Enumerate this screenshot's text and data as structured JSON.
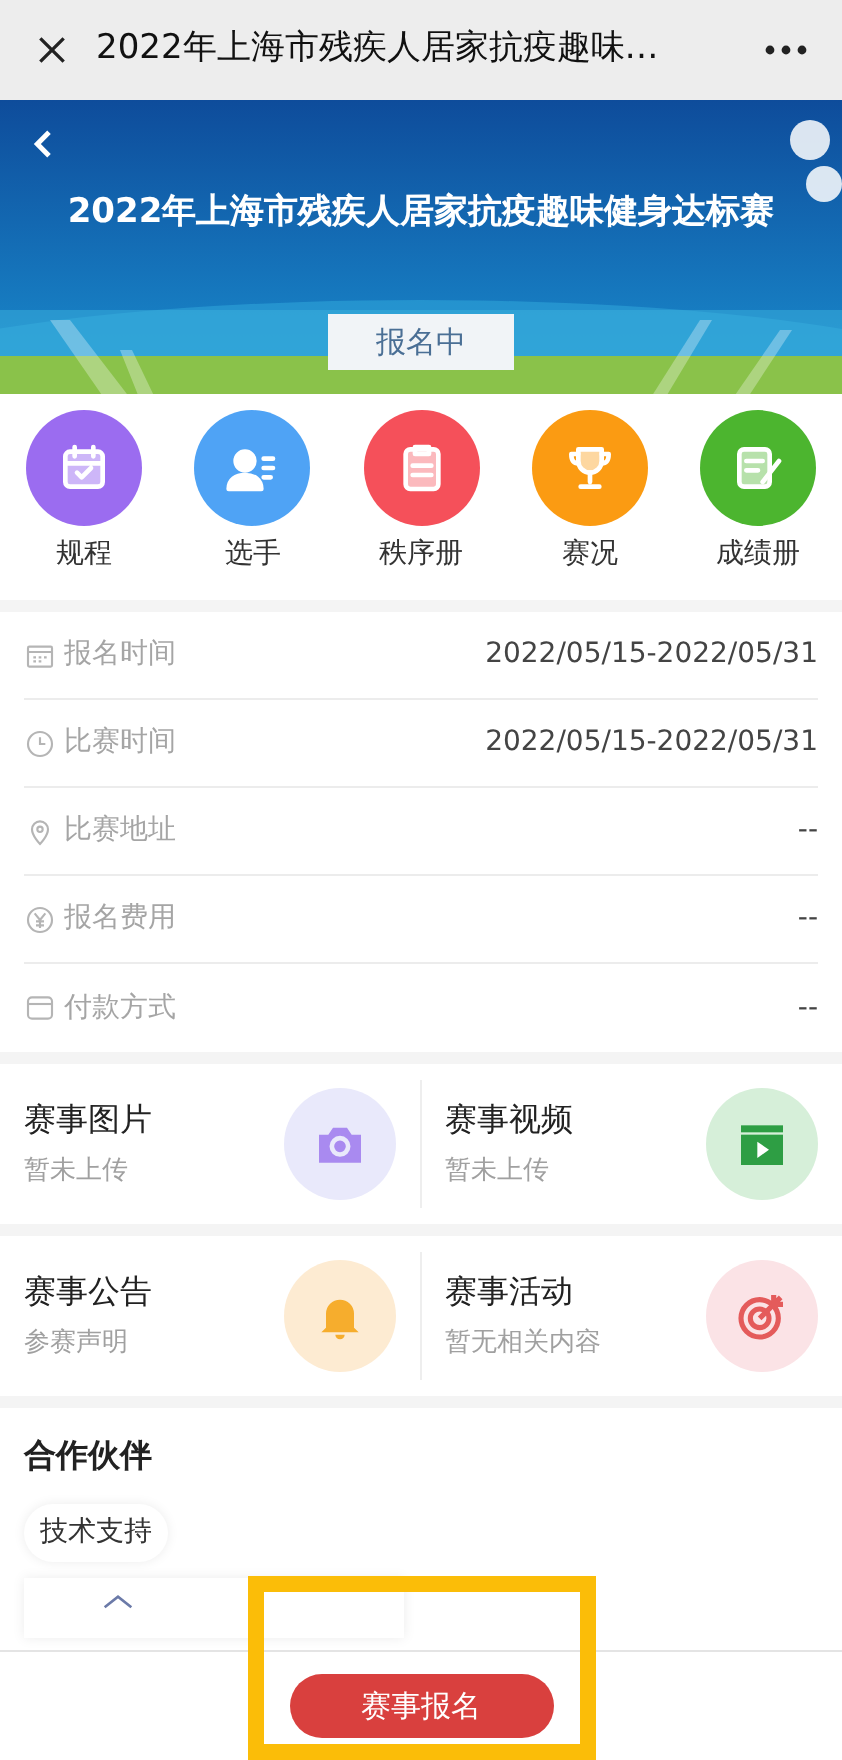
{
  "nav": {
    "title": "2022年上海市残疾人居家抗疫趣味…"
  },
  "banner": {
    "title": "2022年上海市残疾人居家抗疫趣味健身达标赛",
    "status": "报名中"
  },
  "shortcuts": [
    {
      "label": "规程",
      "kind": "schedule",
      "color": "#9b6cf0"
    },
    {
      "label": "选手",
      "kind": "player",
      "color": "#4fa3f5"
    },
    {
      "label": "秩序册",
      "kind": "clipboard",
      "color": "#f5505a"
    },
    {
      "label": "赛况",
      "kind": "trophy",
      "color": "#fb9b12"
    },
    {
      "label": "成绩册",
      "kind": "notes",
      "color": "#4cb52f"
    }
  ],
  "info": [
    {
      "kind": "calendar",
      "label": "报名时间",
      "value": "2022/05/15-2022/05/31"
    },
    {
      "kind": "clock",
      "label": "比赛时间",
      "value": "2022/05/15-2022/05/31"
    },
    {
      "kind": "pin",
      "label": "比赛地址",
      "value": "--"
    },
    {
      "kind": "yen",
      "label": "报名费用",
      "value": "--"
    },
    {
      "kind": "card",
      "label": "付款方式",
      "value": "--"
    }
  ],
  "cards": [
    {
      "kind": "camera",
      "title": "赛事图片",
      "subtitle": "暂未上传"
    },
    {
      "kind": "video",
      "title": "赛事视频",
      "subtitle": "暂未上传"
    },
    {
      "kind": "bell",
      "title": "赛事公告",
      "subtitle": "参赛声明"
    },
    {
      "kind": "target",
      "title": "赛事活动",
      "subtitle": "暂无相关内容"
    }
  ],
  "partners": {
    "title": "合作伙伴",
    "tag": "技术支持"
  },
  "footer": {
    "button": "赛事报名"
  }
}
